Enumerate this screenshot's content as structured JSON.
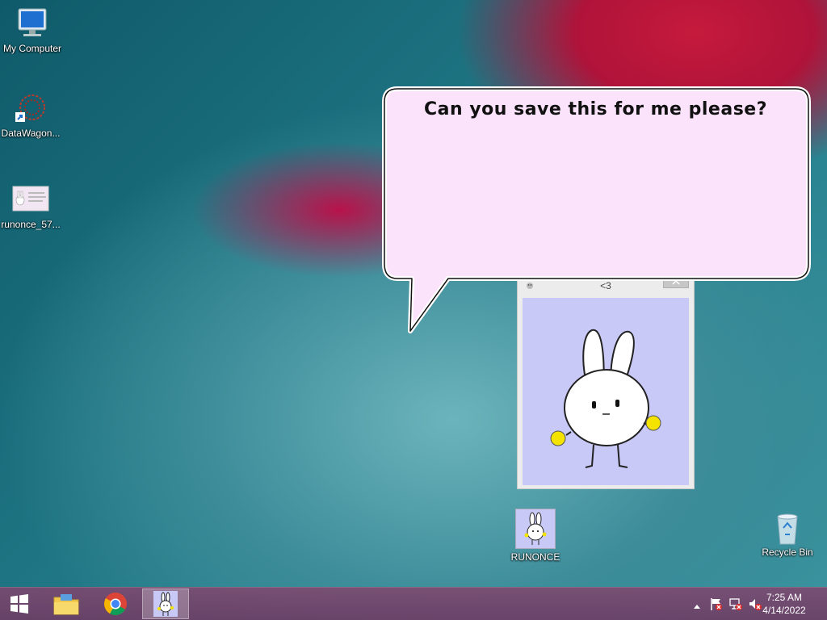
{
  "desktop_icons": [
    {
      "label": "My Computer",
      "icon": "computer-icon"
    },
    {
      "label": "DataWagon...",
      "icon": "datawagon-shortcut-icon"
    },
    {
      "label": "runonce_57...",
      "icon": "image-file-icon"
    },
    {
      "label": "RUNONCE",
      "icon": "bunny-app-icon"
    },
    {
      "label": "Recycle Bin",
      "icon": "recycle-bin-icon"
    }
  ],
  "speech_bubble": {
    "text": "Can you save this for me please?"
  },
  "pet_window": {
    "title": "<3"
  },
  "taskbar": {
    "apps": [
      {
        "name": "start",
        "icon": "windows-start-icon"
      },
      {
        "name": "file-explorer",
        "icon": "folder-icon"
      },
      {
        "name": "chrome",
        "icon": "chrome-icon"
      },
      {
        "name": "runonce",
        "icon": "bunny-app-icon"
      }
    ],
    "tray_icons": [
      "show-hidden-icons-arrow",
      "action-center-flag-icon",
      "network-icon",
      "volume-muted-icon"
    ],
    "time": "7:25 AM",
    "date": "4/14/2022"
  },
  "colors": {
    "bubble_fill": "#fbe3fc",
    "pet_canvas": "#c9c9f7",
    "taskbar": "#7a4670"
  }
}
